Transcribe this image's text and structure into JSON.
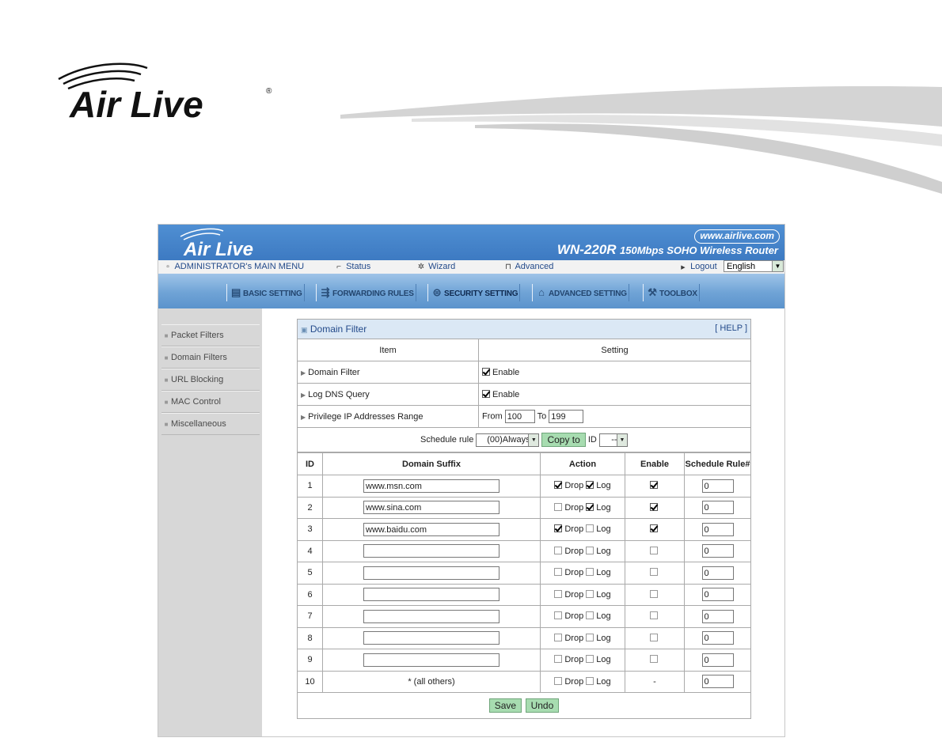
{
  "brand": {
    "logo_text": "Air Live"
  },
  "router": {
    "url": "www.airlive.com",
    "model": "WN-220R",
    "model_desc": "150Mbps SOHO Wireless Router",
    "menu": {
      "main_menu": "ADMINISTRATOR's MAIN MENU",
      "status": "Status",
      "wizard": "Wizard",
      "advanced": "Advanced",
      "logout": "Logout",
      "language": "English"
    },
    "tabs": [
      "BASIC SETTING",
      "FORWARDING RULES",
      "SECURITY SETTING",
      "ADVANCED SETTING",
      "TOOLBOX"
    ],
    "sidebar": [
      "Packet Filters",
      "Domain Filters",
      "URL Blocking",
      "MAC Control",
      "Miscellaneous"
    ]
  },
  "panel": {
    "title": "Domain Filter",
    "help": "[ HELP ]",
    "col_item": "Item",
    "col_setting": "Setting",
    "domain_filter_label": "Domain Filter",
    "domain_filter_enable": "Enable",
    "log_dns_label": "Log DNS Query",
    "log_dns_enable": "Enable",
    "priv_label": "Privilege IP Addresses Range",
    "from_label": "From",
    "from_value": "100",
    "to_label": "To",
    "to_value": "199",
    "schedule_label": "Schedule rule",
    "schedule_value": "(00)Always",
    "copy_btn": "Copy to",
    "id_label": "ID",
    "id_value": "--",
    "h_id": "ID",
    "h_suffix": "Domain Suffix",
    "h_action": "Action",
    "h_enable": "Enable",
    "h_schedule": "Schedule Rule#",
    "drop_label": "Drop",
    "log_label": "Log",
    "others_label": "* (all others)",
    "others_enable": "-",
    "save_btn": "Save",
    "undo_btn": "Undo"
  },
  "rows": [
    {
      "id": "1",
      "suffix": "www.msn.com",
      "drop": true,
      "log": true,
      "enable": true,
      "rule": "0"
    },
    {
      "id": "2",
      "suffix": "www.sina.com",
      "drop": false,
      "log": true,
      "enable": true,
      "rule": "0"
    },
    {
      "id": "3",
      "suffix": "www.baidu.com",
      "drop": true,
      "log": false,
      "enable": true,
      "rule": "0"
    },
    {
      "id": "4",
      "suffix": "",
      "drop": false,
      "log": false,
      "enable": false,
      "rule": "0"
    },
    {
      "id": "5",
      "suffix": "",
      "drop": false,
      "log": false,
      "enable": false,
      "rule": "0"
    },
    {
      "id": "6",
      "suffix": "",
      "drop": false,
      "log": false,
      "enable": false,
      "rule": "0"
    },
    {
      "id": "7",
      "suffix": "",
      "drop": false,
      "log": false,
      "enable": false,
      "rule": "0"
    },
    {
      "id": "8",
      "suffix": "",
      "drop": false,
      "log": false,
      "enable": false,
      "rule": "0"
    },
    {
      "id": "9",
      "suffix": "",
      "drop": false,
      "log": false,
      "enable": false,
      "rule": "0"
    },
    {
      "id": "10",
      "suffix": "",
      "drop": false,
      "log": false,
      "enable": null,
      "rule": "0"
    }
  ]
}
